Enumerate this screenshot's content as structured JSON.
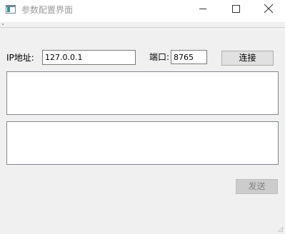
{
  "window": {
    "title": "参数配置界面",
    "icons": {
      "app": "window-app-icon",
      "minimize": "minimize-icon",
      "maximize": "maximize-icon",
      "close": "close-icon"
    }
  },
  "form": {
    "ip_label": "IP地址:",
    "ip_value": "127.0.0.1",
    "port_label": "端口:",
    "port_value": "8765",
    "connect_label": "连接",
    "receive_text": "",
    "send_text": "",
    "send_label": "发送"
  },
  "colors": {
    "window_background": "#f0f0f0",
    "titlebar_background": "#ffffff",
    "disabled_text": "#838383"
  }
}
